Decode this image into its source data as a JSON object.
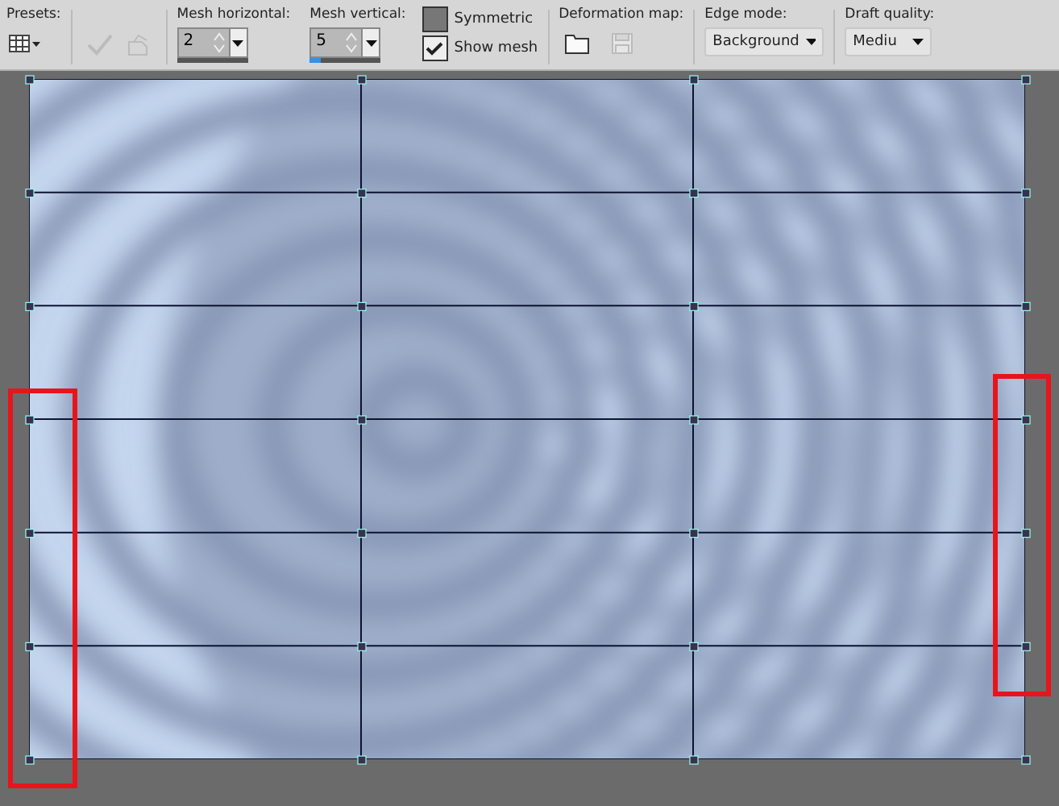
{
  "toolbar": {
    "presets": {
      "label": "Presets:"
    },
    "mesh_horizontal": {
      "label": "Mesh horizontal:",
      "value": "2"
    },
    "mesh_vertical": {
      "label": "Mesh vertical:",
      "value": "5",
      "level": 0.15
    },
    "checkboxes": [
      {
        "label": "Symmetric",
        "checked": false
      },
      {
        "label": "Show mesh",
        "checked": true
      }
    ],
    "deformation_map": {
      "label": "Deformation map:"
    },
    "edge_mode": {
      "label": "Edge mode:",
      "value": "Background"
    },
    "draft_quality": {
      "label": "Draft quality:",
      "value": "Mediu"
    }
  }
}
